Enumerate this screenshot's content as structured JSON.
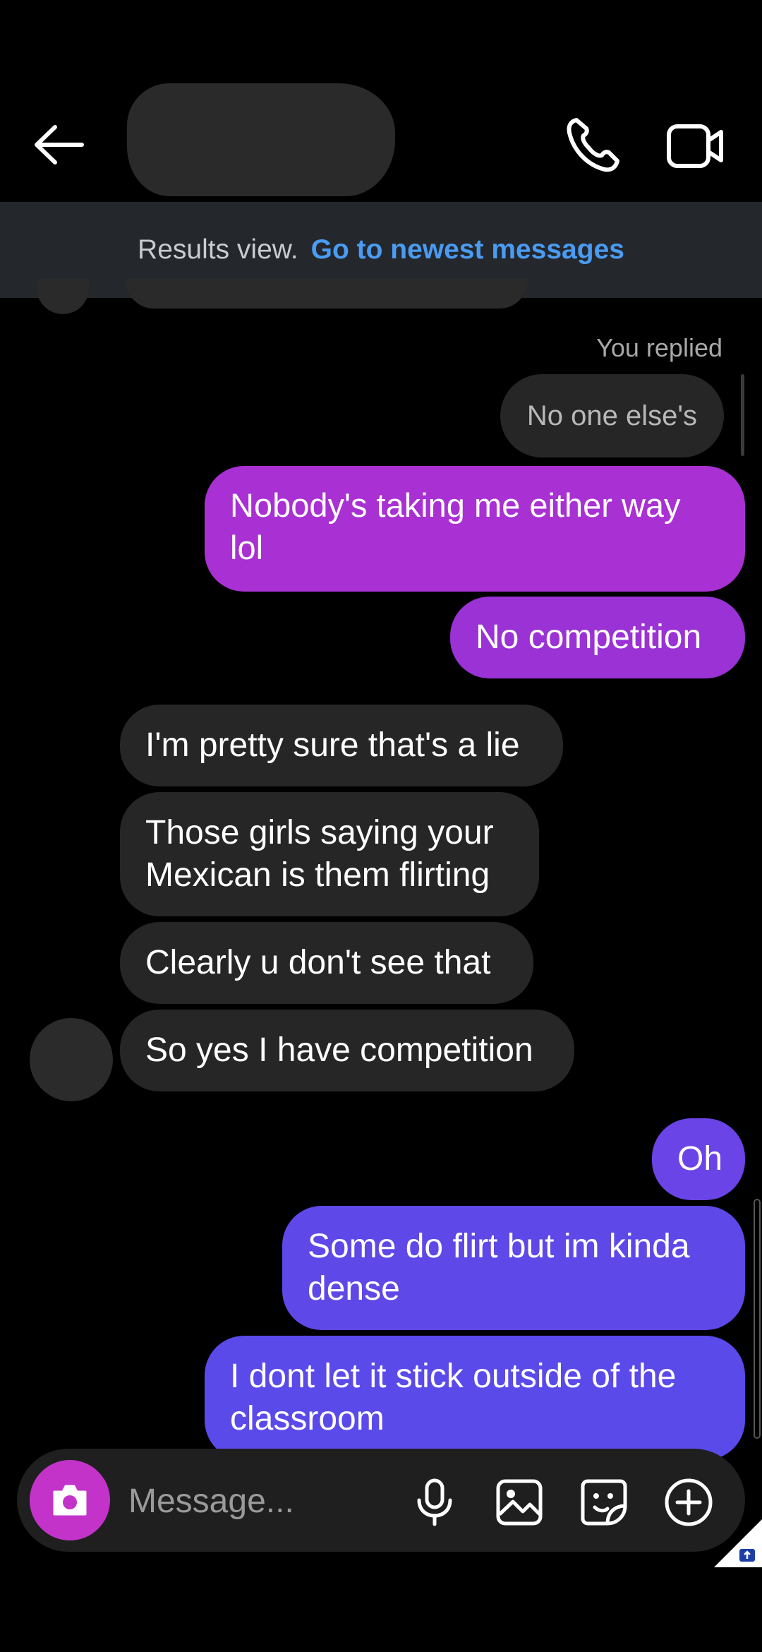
{
  "header": {
    "back_icon": "arrow-left-icon",
    "call_icon": "phone-icon",
    "video_icon": "video-camera-icon"
  },
  "results_bar": {
    "label": "Results view.",
    "link": "Go to newest messages"
  },
  "thread": {
    "replied_label": "You replied",
    "quoted_text": "No one else's",
    "messages": [
      {
        "from": "me",
        "text": "Nobody's taking me either way lol"
      },
      {
        "from": "me",
        "text": "No competition"
      },
      {
        "from": "them",
        "text": "I'm pretty sure that's a lie"
      },
      {
        "from": "them",
        "text": "Those girls saying your Mexican is them flirting"
      },
      {
        "from": "them",
        "text": "Clearly u don't see that"
      },
      {
        "from": "them",
        "text": "So yes I have competition"
      },
      {
        "from": "me",
        "text": "Oh"
      },
      {
        "from": "me",
        "text": "Some do flirt but im kinda dense"
      },
      {
        "from": "me",
        "text": "I dont let it stick outside of the classroom"
      }
    ]
  },
  "composer": {
    "placeholder": "Message...",
    "camera_icon": "camera-icon",
    "mic_icon": "microphone-icon",
    "gallery_icon": "image-icon",
    "sticker_icon": "sticker-icon",
    "more_icon": "plus-circle-icon"
  },
  "colors": {
    "accent_link": "#4a9bf2",
    "my_bubble_top": "#a82fd3",
    "my_bubble_bottom": "#5b4aea",
    "their_bubble": "#262626",
    "camera_button": "#c333c9"
  }
}
